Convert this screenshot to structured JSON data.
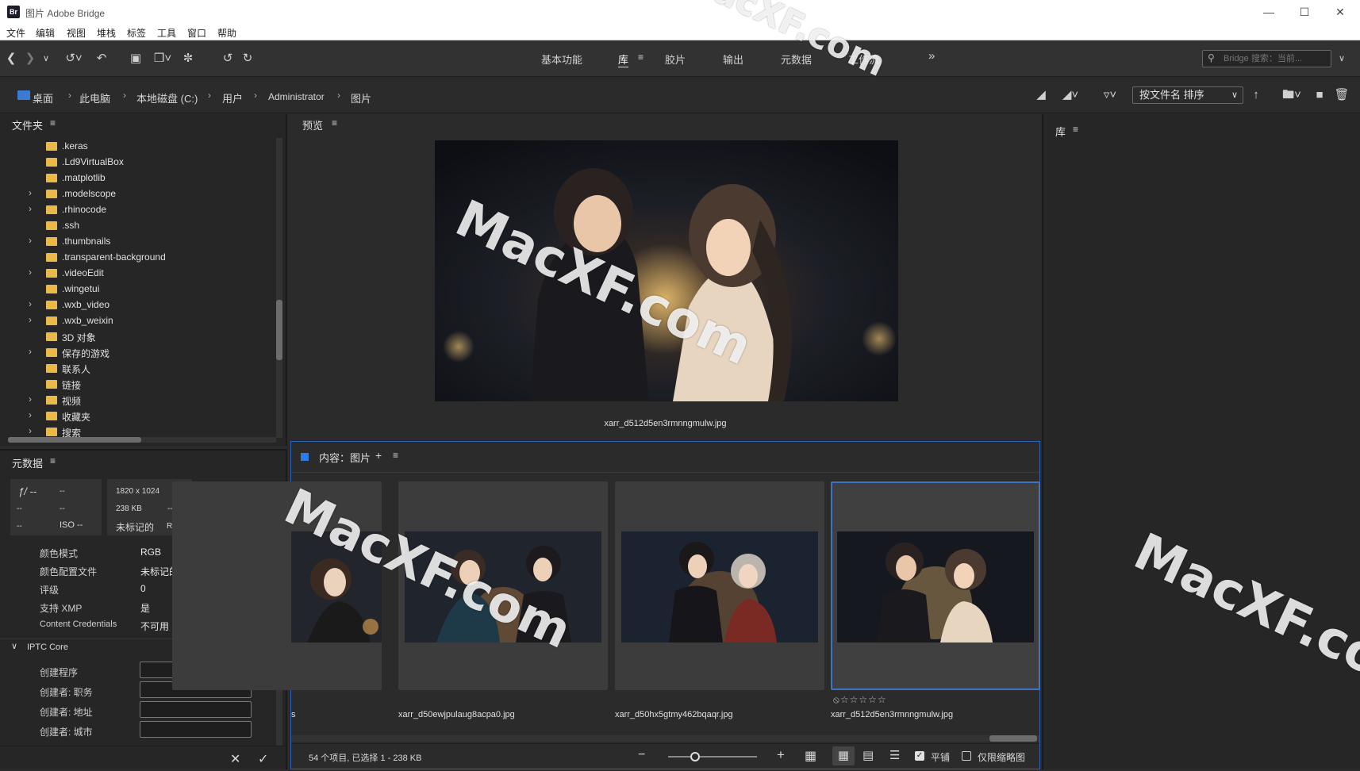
{
  "titlebar": {
    "title": "图片 Adobe Bridge",
    "logo": "Br"
  },
  "menu": [
    "文件",
    "编辑",
    "视图",
    "堆栈",
    "标签",
    "工具",
    "窗口",
    "帮助"
  ],
  "workspaces": {
    "items": [
      "基本功能",
      "库",
      "胶片",
      "输出",
      "元数据",
      "工作流"
    ],
    "active": "库",
    "more": "»"
  },
  "search": {
    "placeholder": "Bridge 搜索：当前..."
  },
  "breadcrumb": [
    "桌面",
    "此电脑",
    "本地磁盘 (C:)",
    "用户",
    "Administrator",
    "图片"
  ],
  "sort": {
    "label": "按文件名 排序"
  },
  "folders_panel": {
    "title": "文件夹",
    "items": [
      {
        "label": ".keras",
        "expandable": false
      },
      {
        "label": ".Ld9VirtualBox",
        "expandable": false
      },
      {
        "label": ".matplotlib",
        "expandable": false
      },
      {
        "label": ".modelscope",
        "expandable": true
      },
      {
        "label": ".rhinocode",
        "expandable": true
      },
      {
        "label": ".ssh",
        "expandable": false
      },
      {
        "label": ".thumbnails",
        "expandable": true
      },
      {
        "label": ".transparent-background",
        "expandable": false
      },
      {
        "label": ".videoEdit",
        "expandable": true
      },
      {
        "label": ".wingetui",
        "expandable": false
      },
      {
        "label": ".wxb_video",
        "expandable": true
      },
      {
        "label": ".wxb_weixin",
        "expandable": true
      },
      {
        "label": "3D 对象",
        "expandable": false
      },
      {
        "label": "保存的游戏",
        "expandable": true
      },
      {
        "label": "联系人",
        "expandable": false
      },
      {
        "label": "链接",
        "expandable": false
      },
      {
        "label": "视频",
        "expandable": true
      },
      {
        "label": "收藏夹",
        "expandable": true
      },
      {
        "label": "搜索",
        "expandable": true
      }
    ]
  },
  "metadata_panel": {
    "title": "元数据",
    "camera": {
      "aperture": "ƒ/ --",
      "shutter": "--",
      "a": "--",
      "b": "--",
      "c": "--",
      "iso": "ISO --"
    },
    "file": {
      "dimensions": "1820 x 1024",
      "size": "238 KB",
      "dash": "--",
      "color_profile": "未标记的",
      "mode": "RGB"
    },
    "rows": [
      {
        "key": "颜色模式",
        "value": "RGB"
      },
      {
        "key": "颜色配置文件",
        "value": "未标记的"
      },
      {
        "key": "评级",
        "value": "0"
      },
      {
        "key": "支持 XMP",
        "value": "是"
      },
      {
        "key": "Content Credentials",
        "value": "不可用"
      }
    ],
    "iptc": {
      "title": "IPTC Core",
      "fields": [
        "创建程序",
        "创建者: 职务",
        "创建者: 地址",
        "创建者: 城市"
      ]
    }
  },
  "preview_panel": {
    "title": "预览",
    "filename": "xarr_d512d5en3rmnngmulw.jpg"
  },
  "content_panel": {
    "title": "内容：图片",
    "thumbs": [
      {
        "name": "s"
      },
      {
        "name": "xarr_d50ewjpulaug8acpa0.jpg"
      },
      {
        "name": "xarr_d50hx5gtmy462bqaqr.jpg"
      },
      {
        "name": "xarr_d512d5en3rmnngmulw.jpg",
        "rating": "⦸☆☆☆☆☆"
      }
    ],
    "status": "54 个项目, 已选择 1 - 238 KB",
    "zoom": 0.3,
    "tile_label": "平铺",
    "thumbs_only_label": "仅限缩略图"
  },
  "library_panel": {
    "title": "库"
  },
  "watermark": "MacXF.com",
  "colors": {
    "accent": "#2c63b8",
    "folder": "#e9b94a",
    "bg": "#2b2b2b"
  }
}
